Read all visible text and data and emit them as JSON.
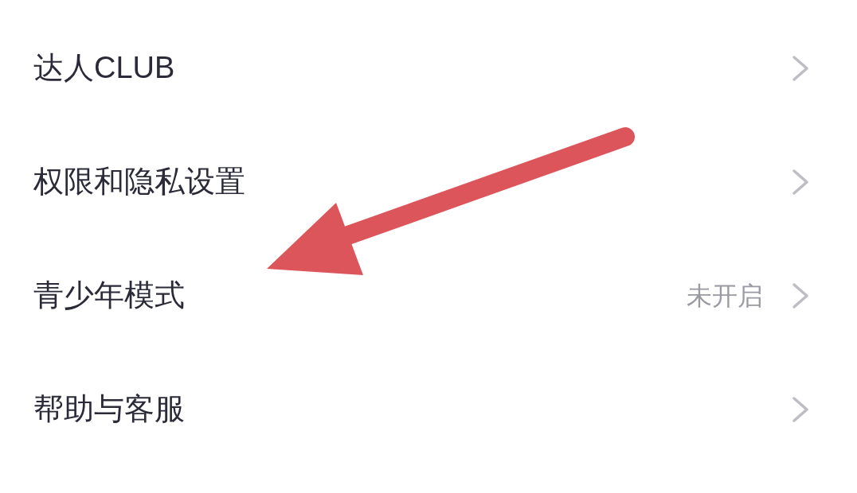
{
  "menu": {
    "items": [
      {
        "label": "达人CLUB"
      },
      {
        "label": "权限和隐私设置"
      },
      {
        "label": "青少年模式",
        "value": "未开启"
      },
      {
        "label": "帮助与客服"
      }
    ]
  }
}
